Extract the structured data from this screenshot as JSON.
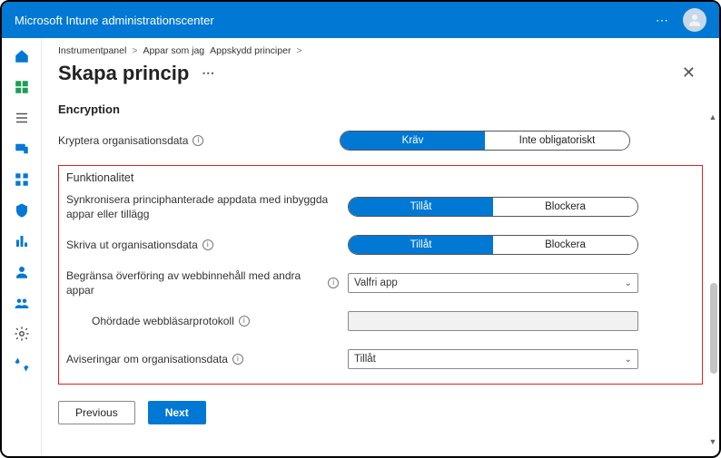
{
  "header": {
    "title": "Microsoft Intune administrationscenter"
  },
  "breadcrumb": {
    "item1": "Instrumentpanel",
    "sep1": ">",
    "item2": "Appar som jag",
    "item3": "Appskydd principer",
    "sep2": ">"
  },
  "page": {
    "title": "Skapa princip"
  },
  "encryption": {
    "section": "Encryption",
    "encrypt_label": "Kryptera organisationsdata",
    "encrypt_opt1": "Kräv",
    "encrypt_opt2": "Inte obligatoriskt"
  },
  "functionality": {
    "section": "Funktionalitet",
    "sync_label": "Synkronisera principhanterade appdata med inbyggda appar eller tillägg",
    "sync_opt1": "Tillåt",
    "sync_opt2": "Blockera",
    "print_label": "Skriva ut organisationsdata",
    "print_opt1": "Tillåt",
    "print_opt2": "Blockera",
    "restrict_label": "Begränsa överföring av webbinnehåll med andra appar",
    "restrict_value": "Valfri app",
    "protocols_label": "Ohördade webbläsarprotokoll",
    "notifications_label": "Aviseringar om organisationsdata",
    "notifications_value": "Tillåt"
  },
  "footer": {
    "previous": "Previous",
    "next": "Next"
  }
}
